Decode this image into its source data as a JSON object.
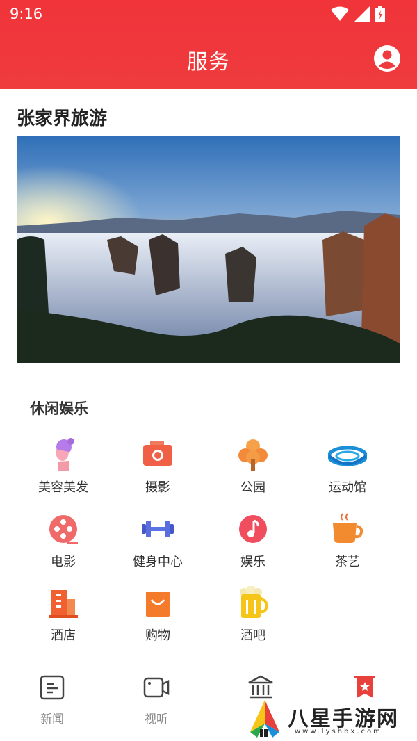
{
  "status_bar": {
    "time": "9:16"
  },
  "header": {
    "title": "服务",
    "profile_icon": "account-circle-icon"
  },
  "destination": {
    "title": "张家界旅游"
  },
  "leisure": {
    "title": "休闲娱乐",
    "items": [
      {
        "label": "美容美发",
        "icon": "beauty-salon-icon"
      },
      {
        "label": "摄影",
        "icon": "camera-icon"
      },
      {
        "label": "公园",
        "icon": "park-tree-icon"
      },
      {
        "label": "运动馆",
        "icon": "stadium-icon"
      },
      {
        "label": "电影",
        "icon": "film-reel-icon"
      },
      {
        "label": "健身中心",
        "icon": "dumbbell-icon"
      },
      {
        "label": "娱乐",
        "icon": "music-note-icon"
      },
      {
        "label": "茶艺",
        "icon": "tea-cup-icon"
      },
      {
        "label": "酒店",
        "icon": "hotel-building-icon"
      },
      {
        "label": "购物",
        "icon": "shopping-bag-icon"
      },
      {
        "label": "酒吧",
        "icon": "beer-mug-icon"
      }
    ]
  },
  "bottom_nav": {
    "items": [
      {
        "label": "新闻",
        "icon": "news-icon"
      },
      {
        "label": "视听",
        "icon": "video-camera-icon"
      },
      {
        "label": "",
        "icon": "government-building-icon"
      },
      {
        "label": "",
        "icon": "bookmark-star-icon"
      }
    ]
  },
  "watermark": {
    "text": "八星手游网",
    "url": "www.lyshbx.com"
  },
  "colors": {
    "header_red": "#ef3b3e",
    "accent_red": "#e8413b",
    "nav_gray": "#888888"
  }
}
